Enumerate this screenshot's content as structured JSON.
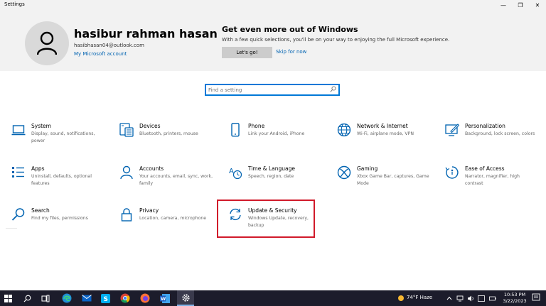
{
  "window": {
    "title": "Settings",
    "minimize_glyph": "—",
    "maximize_glyph": "❐",
    "close_glyph": "✕"
  },
  "account": {
    "name": "hasibur rahman hasan",
    "email": "hasibhasan04@outlook.com",
    "link": "My Microsoft account",
    "avatar_icon": "person-icon"
  },
  "promo": {
    "title": "Get even more out of Windows",
    "text": "With a few quick selections, you'll be on your way to enjoying the full Microsoft experience.",
    "primary_button": "Let's go!",
    "secondary_link": "Skip for now"
  },
  "search": {
    "placeholder": "Find a setting",
    "icon": "search-icon"
  },
  "tiles": [
    {
      "name": "System",
      "desc": "Display, sound, notifications, power",
      "icon": "laptop-icon"
    },
    {
      "name": "Devices",
      "desc": "Bluetooth, printers, mouse",
      "icon": "keyboard-icon"
    },
    {
      "name": "Phone",
      "desc": "Link your Android, iPhone",
      "icon": "phone-icon"
    },
    {
      "name": "Network & Internet",
      "desc": "Wi-Fi, airplane mode, VPN",
      "icon": "globe-icon"
    },
    {
      "name": "Personalization",
      "desc": "Background, lock screen, colors",
      "icon": "paint-icon"
    },
    {
      "name": "Apps",
      "desc": "Uninstall, defaults, optional features",
      "icon": "apps-list-icon"
    },
    {
      "name": "Accounts",
      "desc": "Your accounts, email, sync, work, family",
      "icon": "person-icon"
    },
    {
      "name": "Time & Language",
      "desc": "Speech, region, date",
      "icon": "time-language-icon"
    },
    {
      "name": "Gaming",
      "desc": "Xbox Game Bar, captures, Game Mode",
      "icon": "xbox-icon"
    },
    {
      "name": "Ease of Access",
      "desc": "Narrator, magnifier, high contrast",
      "icon": "ease-of-access-icon"
    },
    {
      "name": "Search",
      "desc": "Find my files, permissions",
      "icon": "search-icon"
    },
    {
      "name": "Privacy",
      "desc": "Location, camera, microphone",
      "icon": "lock-icon"
    },
    {
      "name": "Update & Security",
      "desc": "Windows Update, recovery, backup",
      "icon": "sync-icon"
    }
  ],
  "taskbar": {
    "weather": "74°F  Haze",
    "time": "10:53 PM",
    "date": "3/22/2023",
    "items": [
      "start-icon",
      "search-icon",
      "task-view-icon",
      "edge-icon",
      "skype-icon",
      "chrome-icon",
      "firefox-icon",
      "word-icon",
      "settings-gear-icon"
    ]
  },
  "colors": {
    "accent": "#0078d7",
    "highlight": "#d11a2a",
    "header_bg": "#f2f2f2",
    "taskbar_bg": "#1c1c2b"
  }
}
